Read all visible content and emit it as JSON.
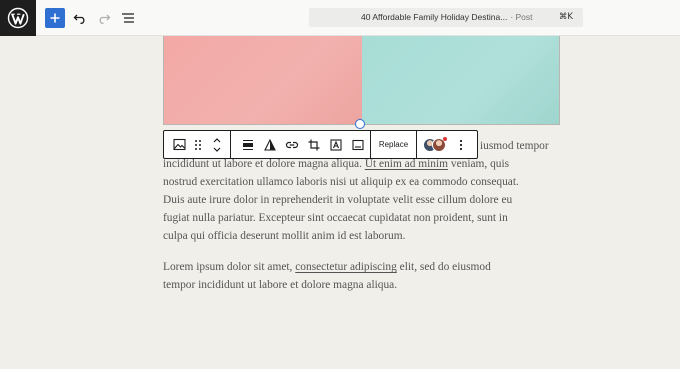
{
  "header": {
    "document_title": "40 Affordable Family Holiday Destina...",
    "post_type": "· Post",
    "shortcut": "⌘K"
  },
  "toolbar": {
    "replace_label": "Replace"
  },
  "content": {
    "para1": {
      "line1_end": "iusmod tempor",
      "line2_a": "incididunt ut labore et dolore magna aliqua. ",
      "line2_link": "Ut enim ad minim",
      "line2_b": " veniam, quis",
      "line3": "nostrud exercitation ullamco laboris nisi ut aliquip ex ea commodo consequat.",
      "line4": "Duis aute irure dolor in reprehenderit in voluptate velit esse cillum dolore eu",
      "line5": "fugiat nulla pariatur. Excepteur sint occaecat cupidatat non proident, sunt in",
      "line6": "culpa qui officia deserunt mollit anim id est laborum."
    },
    "para2": {
      "line1_a": "Lorem ipsum dolor sit amet, ",
      "line1_link": "consectetur adipiscing",
      "line1_b": " elit, sed do eiusmod",
      "line2": "tempor incididunt ut labore et dolore magna aliqua."
    }
  },
  "colors": {
    "accent": "#2f6fd1",
    "image_left": "#f2b1ae",
    "image_right": "#a7ddd6"
  }
}
